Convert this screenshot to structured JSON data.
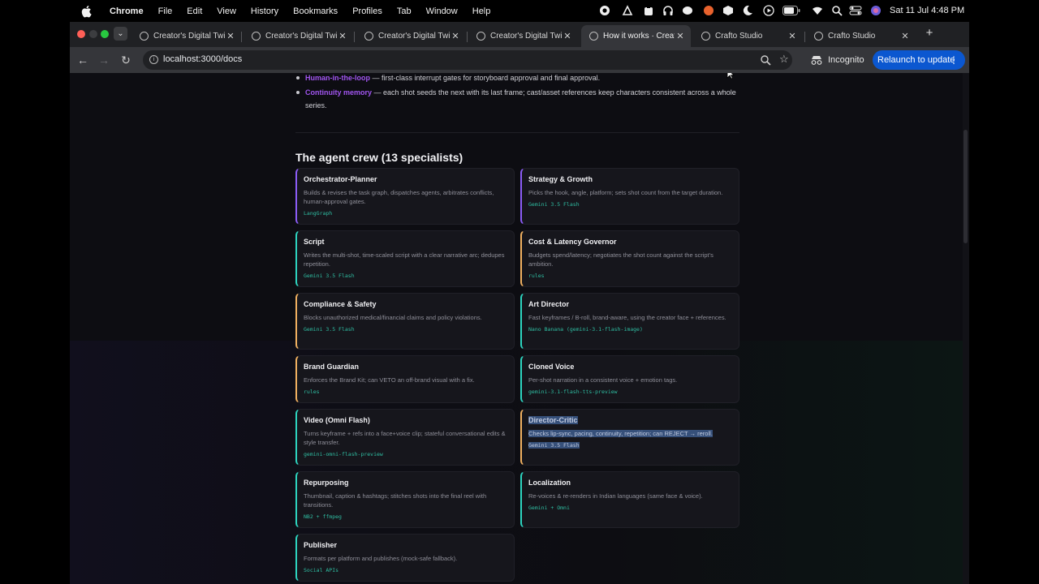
{
  "menubar": {
    "app": "Chrome",
    "items": [
      "File",
      "Edit",
      "View",
      "History",
      "Bookmarks",
      "Profiles",
      "Tab",
      "Window",
      "Help"
    ],
    "clock": "Sat 11 Jul  4:48 PM"
  },
  "tabs": [
    {
      "title": "Creator's Digital Twin"
    },
    {
      "title": "Creator's Digital Twin"
    },
    {
      "title": "Creator's Digital Twin"
    },
    {
      "title": "Creator's Digital Twin"
    },
    {
      "title": "How it works · Creato"
    },
    {
      "title": "Crafto Studio"
    },
    {
      "title": "Crafto Studio"
    }
  ],
  "toolbar": {
    "url": "localhost:3000/docs",
    "incognito": "Incognito",
    "relaunch": "Relaunch to update"
  },
  "bullets": [
    {
      "term": "Human-in-the-loop",
      "text": " — first-class interrupt gates for storyboard approval and final approval."
    },
    {
      "term": "Continuity memory",
      "text": " — each shot seeds the next with its last frame; cast/asset references keep characters consistent across a whole series."
    }
  ],
  "section_title": "The agent crew (13 specialists)",
  "accent_colors": {
    "purple": "#8b5cf6",
    "teal": "#2dd4bf",
    "amber": "#f0b060",
    "selection": "#36507a"
  },
  "cards": [
    {
      "name": "Orchestrator-Planner",
      "desc": "Builds & revises the task graph, dispatches agents, arbitrates conflicts, human-approval gates.",
      "model": "LangGraph"
    },
    {
      "name": "Strategy & Growth",
      "desc": "Picks the hook, angle, platform; sets shot count from the target duration.",
      "model": "Gemini 3.5 Flash"
    },
    {
      "name": "Script",
      "desc": "Writes the multi-shot, time-scaled script with a clear narrative arc; dedupes repetition.",
      "model": "Gemini 3.5 Flash"
    },
    {
      "name": "Cost & Latency Governor",
      "desc": "Budgets spend/latency; negotiates the shot count against the script's ambition.",
      "model": "rules"
    },
    {
      "name": "Compliance & Safety",
      "desc": "Blocks unauthorized medical/financial claims and policy violations.",
      "model": "Gemini 3.5 Flash"
    },
    {
      "name": "Art Director",
      "desc": "Fast keyframes / B-roll, brand-aware, using the creator face + references.",
      "model": "Nano Banana (gemini-3.1-flash-image)"
    },
    {
      "name": "Brand Guardian",
      "desc": "Enforces the Brand Kit; can VETO an off-brand visual with a fix.",
      "model": "rules"
    },
    {
      "name": "Cloned Voice",
      "desc": "Per-shot narration in a consistent voice + emotion tags.",
      "model": "gemini-3.1-flash-tts-preview"
    },
    {
      "name": "Video (Omni Flash)",
      "desc": "Turns keyframe + refs into a face+voice clip; stateful conversational edits & style transfer.",
      "model": "gemini-omni-flash-preview"
    },
    {
      "name": "Director-Critic",
      "desc": "Checks lip-sync, pacing, continuity, repetition; can REJECT → reroll.",
      "model": "Gemini 3.5 Flash"
    },
    {
      "name": "Repurposing",
      "desc": "Thumbnail, caption & hashtags; stitches shots into the final reel with transitions.",
      "model": "NB2 + ffmpeg"
    },
    {
      "name": "Localization",
      "desc": "Re-voices & re-renders in Indian languages (same face & voice).",
      "model": "Gemini + Omni"
    },
    {
      "name": "Publisher",
      "desc": "Formats per platform and publishes (mock-safe fallback).",
      "model": "Social APIs"
    }
  ]
}
